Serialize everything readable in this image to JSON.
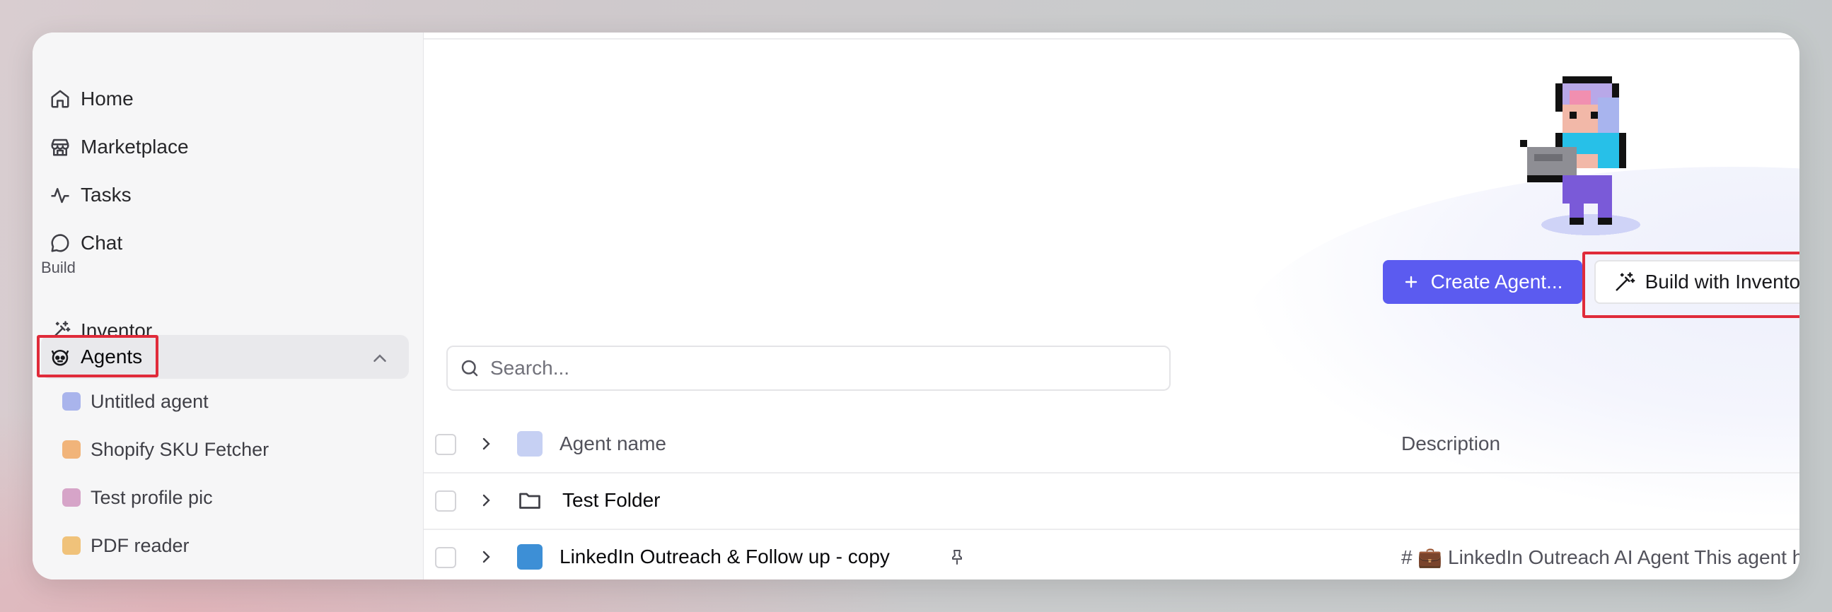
{
  "sidebar": {
    "nav": [
      {
        "label": "Home",
        "icon": "home-icon"
      },
      {
        "label": "Marketplace",
        "icon": "store-icon"
      },
      {
        "label": "Tasks",
        "icon": "activity-icon"
      },
      {
        "label": "Chat",
        "icon": "chat-bubble-icon"
      }
    ],
    "section_label": "Build",
    "inventor_label": "Inventor",
    "agents_label": "Agents",
    "agents_children": [
      {
        "label": "Untitled agent"
      },
      {
        "label": "Shopify SKU Fetcher"
      },
      {
        "label": "Test profile pic"
      },
      {
        "label": "PDF reader"
      }
    ]
  },
  "main": {
    "create_button": "Create Agent...",
    "build_button": "Build with Inventor",
    "search_placeholder": "Search...",
    "table": {
      "columns": {
        "name": "Agent name",
        "description": "Description"
      },
      "rows": [
        {
          "name": "Test Folder",
          "type": "folder",
          "description": ""
        },
        {
          "name": "LinkedIn Outreach & Follow up - copy",
          "type": "agent",
          "pinned": true,
          "description": "# 💼 LinkedIn Outreach AI Agent This agent hel"
        }
      ]
    }
  },
  "colors": {
    "accent": "#5b5bf0",
    "highlight": "#e02b3a"
  }
}
